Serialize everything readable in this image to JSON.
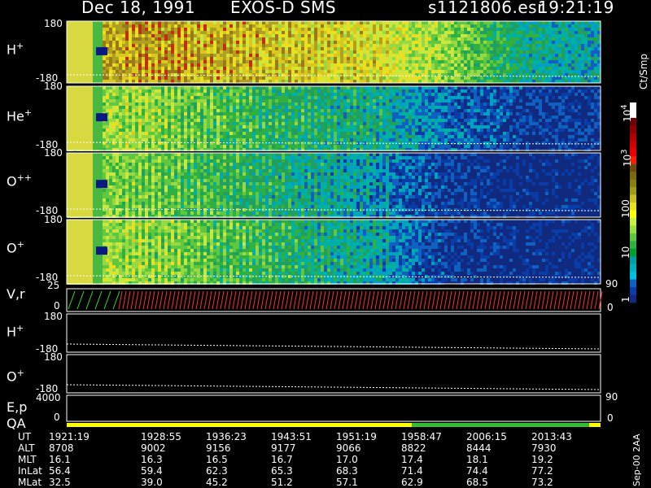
{
  "header": {
    "date": "Dec 18, 1991",
    "instrument": "EXOS-D SMS",
    "file": "s1121806.esr",
    "time": "19:21:19"
  },
  "panels": [
    {
      "label": "H",
      "sup": "+",
      "ymax": "180",
      "ymin": "-180"
    },
    {
      "label": "He",
      "sup": "+",
      "ymax": "180",
      "ymin": "-180"
    },
    {
      "label": "O",
      "sup": "++",
      "ymax": "180",
      "ymin": "-180"
    },
    {
      "label": "O",
      "sup": "+",
      "ymax": "180",
      "ymin": "-180"
    }
  ],
  "vr_panel": {
    "label": "V,r",
    "ymax": "25",
    "ymin": "0",
    "right_top": "90",
    "right_bot": "0"
  },
  "lower_panels": [
    {
      "label": "H",
      "sup": "+",
      "ymax": "180",
      "ymin": "-180"
    },
    {
      "label": "O",
      "sup": "+",
      "ymax": "180",
      "ymin": "-180"
    }
  ],
  "ep_panel": {
    "label": "E,p",
    "ymax": "4000",
    "ymin": "0",
    "right_top": "90",
    "right_bot": "0"
  },
  "qa_label": "QA",
  "colorbar": {
    "unit": "Ct/Smp",
    "labels": [
      "10",
      "10",
      "100",
      "10",
      "1"
    ],
    "sups": [
      "4",
      "3",
      "",
      "",
      ""
    ],
    "colors": [
      "#ffffff",
      "#ffffff",
      "#6e0000",
      "#8c0000",
      "#b00000",
      "#d00000",
      "#ee0000",
      "#ff2000",
      "#6e4a10",
      "#7a6a10",
      "#8a8010",
      "#a09a18",
      "#c8c020",
      "#e8e020",
      "#ffff00",
      "#c8f040",
      "#98e040",
      "#60c840",
      "#30b040",
      "#00a030",
      "#00a0a0",
      "#00b0c0",
      "#00c0e0",
      "#1060c0",
      "#0a3ca8",
      "#102a80"
    ]
  },
  "table": {
    "rows": [
      {
        "name": "UT",
        "values": [
          "1921:19",
          "1928:55",
          "1936:23",
          "1943:51",
          "1951:19",
          "1958:47",
          "2006:15",
          "2013:43"
        ]
      },
      {
        "name": "ALT",
        "values": [
          "8708",
          "9002",
          "9156",
          "9177",
          "9066",
          "8822",
          "8444",
          "7930"
        ]
      },
      {
        "name": "MLT",
        "values": [
          "16.1",
          "16.3",
          "16.5",
          "16.7",
          "17.0",
          "17.4",
          "18.1",
          "19.2"
        ]
      },
      {
        "name": "InLat",
        "values": [
          "56.4",
          "59.4",
          "62.3",
          "65.3",
          "68.3",
          "71.4",
          "74.4",
          "77.2"
        ]
      },
      {
        "name": "MLat",
        "values": [
          "32.5",
          "39.0",
          "45.2",
          "51.2",
          "57.1",
          "62.9",
          "68.5",
          "73.2"
        ]
      }
    ]
  },
  "footer_note": "Sep-00 2AA",
  "chart_data": {
    "type": "heatmap",
    "title": "Dec 18, 1991   EXOS-D SMS",
    "subtitle": "s1121806.esr  19:21:19",
    "x": [
      "1921:19",
      "1928:55",
      "1936:23",
      "1943:51",
      "1951:19",
      "1958:47",
      "2006:15",
      "2013:43"
    ],
    "series": [
      {
        "name": "H+",
        "ylim": [
          -180,
          180
        ],
        "intensity": [
          0.8,
          0.85,
          0.8,
          0.75,
          0.7,
          0.55,
          0.3,
          0.25
        ]
      },
      {
        "name": "He+",
        "ylim": [
          -180,
          180
        ],
        "intensity": [
          0.6,
          0.55,
          0.45,
          0.35,
          0.3,
          0.15,
          0.05,
          0.05
        ]
      },
      {
        "name": "O++",
        "ylim": [
          -180,
          180
        ],
        "intensity": [
          0.6,
          0.5,
          0.4,
          0.3,
          0.2,
          0.05,
          0.0,
          0.0
        ]
      },
      {
        "name": "O+",
        "ylim": [
          -180,
          180
        ],
        "intensity": [
          0.65,
          0.55,
          0.45,
          0.35,
          0.25,
          0.05,
          0.0,
          0.0
        ]
      }
    ],
    "colorbar_unit": "Ct/Smp",
    "colorbar_range": [
      1,
      10000
    ],
    "colorbar_scale": "log"
  }
}
